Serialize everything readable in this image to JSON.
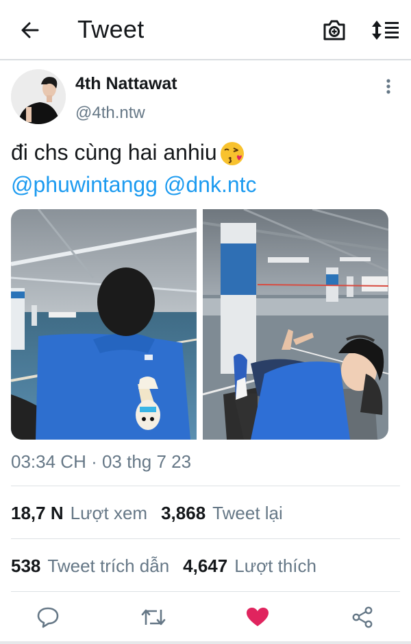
{
  "header": {
    "title": "Tweet",
    "back_icon": "arrow-left-icon",
    "camera_icon": "camera-icon",
    "sort_icon": "sort-icon"
  },
  "author": {
    "display_name": "4th Nattawat",
    "handle": "@4th.ntw"
  },
  "tweet": {
    "text": "đi chs cùng hai anhiu",
    "emoji": "kissing-heart-emoji",
    "mentions": [
      "@phuwintangg",
      "@dnk.ntc"
    ],
    "timestamp": "03:34 CH · 03 thg 7 23"
  },
  "stats": {
    "views": {
      "value": "18,7 N",
      "label": "Lượt xem"
    },
    "retweets": {
      "value": "3,868",
      "label": "Tweet lại"
    },
    "quotes": {
      "value": "538",
      "label": "Tweet trích dẫn"
    },
    "likes": {
      "value": "4,647",
      "label": "Lượt thích"
    }
  },
  "actions": [
    {
      "name": "reply",
      "icon": "speech-bubble-icon"
    },
    {
      "name": "retweet",
      "icon": "retweet-icon"
    },
    {
      "name": "like",
      "icon": "heart-icon",
      "active": true,
      "color": "#e0245e"
    },
    {
      "name": "share",
      "icon": "share-icon"
    }
  ],
  "colors": {
    "accent": "#1d9bf0",
    "muted": "#657786",
    "like": "#e0245e"
  }
}
